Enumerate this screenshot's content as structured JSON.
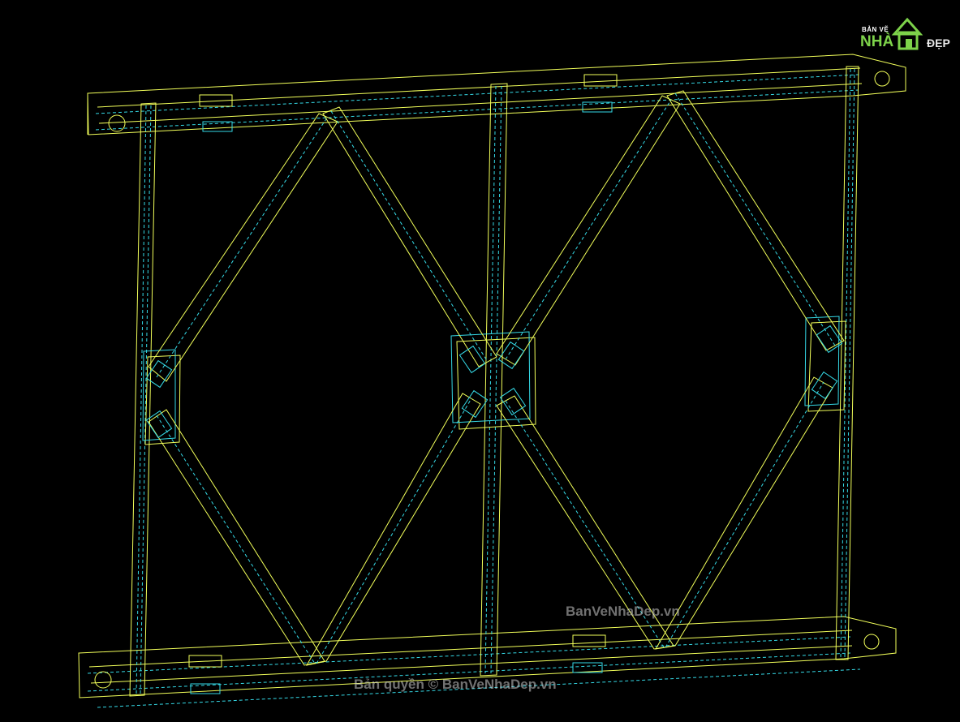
{
  "logo": {
    "line1": "BẢN VẼ",
    "line2": "NHÀ",
    "line3": "ĐẸP"
  },
  "watermark": {
    "site": "BanVeNhaDep.vn",
    "copyright": "Bản quyền © BanVeNhaDep.vn"
  },
  "colors": {
    "background": "#000000",
    "primary_line": "#f2ff5a",
    "secondary_line": "#35d9e6",
    "logo_green": "#7dd24a"
  }
}
